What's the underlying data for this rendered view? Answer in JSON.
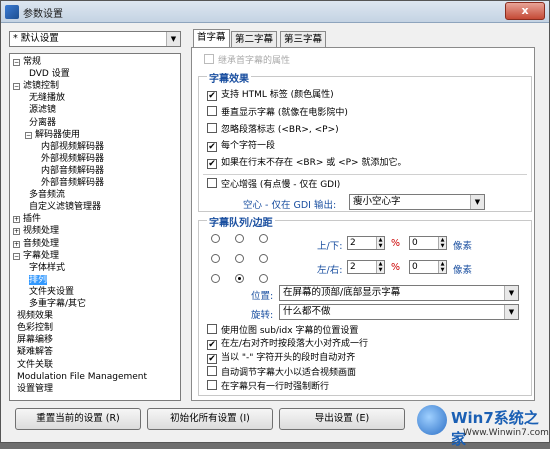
{
  "window": {
    "title": "参数设置",
    "close": "x"
  },
  "left": {
    "preset": "* 默认设置",
    "tree": [
      {
        "label": "常规",
        "expanded": true
      },
      {
        "label": "DVD 设置"
      },
      {
        "label": "滤镜控制",
        "expanded": true
      },
      {
        "label": "无缝播放"
      },
      {
        "label": "源滤镜"
      },
      {
        "label": "分离器"
      },
      {
        "label": "解码器使用",
        "expanded": true
      },
      {
        "label": "内部视频解码器"
      },
      {
        "label": "外部视频解码器"
      },
      {
        "label": "内部音频解码器"
      },
      {
        "label": "外部音频解码器"
      },
      {
        "label": "多音频流"
      },
      {
        "label": "自定义滤镜管理器"
      },
      {
        "label": "插件",
        "expanded": false
      },
      {
        "label": "视频处理",
        "expanded": false
      },
      {
        "label": "音频处理",
        "expanded": false
      },
      {
        "label": "字幕处理",
        "expanded": true
      },
      {
        "label": "字体样式"
      },
      {
        "label": "排列"
      },
      {
        "label": "文件夹设置"
      },
      {
        "label": "多重字幕/其它"
      },
      {
        "label": "视频效果"
      },
      {
        "label": "色彩控制"
      },
      {
        "label": "屏幕编移"
      },
      {
        "label": "疑难解答"
      },
      {
        "label": "文件关联"
      },
      {
        "label": "Modulation File Management"
      },
      {
        "label": "设置管理"
      }
    ]
  },
  "tabs": [
    "首字幕",
    "第二字幕",
    "第三字幕"
  ],
  "panel": {
    "inherit": "继承首字幕的属性",
    "effects": {
      "title": "字幕效果",
      "items": [
        {
          "label": "支持 HTML 标签 (颜色属性)",
          "checked": true
        },
        {
          "label": "垂直显示字幕 (就像在电影院中)",
          "checked": false
        },
        {
          "label": "忽略段落标志 (<BR>, <P>)",
          "checked": false
        },
        {
          "label": "每个字符一段",
          "checked": true
        },
        {
          "label": "如果在行末不存在 <BR> 或 <P> 就添加它。",
          "checked": true
        }
      ],
      "hollow": {
        "label": "空心增强 (有点慢 - 仅在 GDI)",
        "checked": false
      },
      "hollow_out_label": "空心 - 仅在 GDI 输出:",
      "hollow_out_value": "瘦小空心字"
    },
    "queue": {
      "title": "字幕队列/边距",
      "ud_label": "上/下:",
      "ud_value1": "2",
      "ud_value2": "0",
      "lr_label": "左/右:",
      "lr_value1": "2",
      "lr_value2": "0",
      "percent": "%",
      "pixel": "像素",
      "pos_label": "位置:",
      "pos_value": "在屏幕的顶部/底部显示字幕",
      "rot_label": "旋转:",
      "rot_value": "什么都不做",
      "items": [
        {
          "label": "使用位图 sub/idx 字幕的位置设置",
          "checked": false
        },
        {
          "label": "在左/右对齐时按段落大小对齐成一行",
          "checked": true
        },
        {
          "label": "当以 \"-\" 字符开头的段时自动对齐",
          "checked": true
        },
        {
          "label": "自动调节字幕大小以适合视频画面",
          "checked": false
        },
        {
          "label": "在字幕只有一行时强制断行",
          "checked": false
        }
      ]
    }
  },
  "buttons": {
    "reset": "重置当前的设置 (R)",
    "init": "初始化所有设置 (I)",
    "export": "导出设置 (E)"
  },
  "watermark": {
    "title": "Win7系统之家",
    "sub": "Www.Winwin7.com"
  }
}
